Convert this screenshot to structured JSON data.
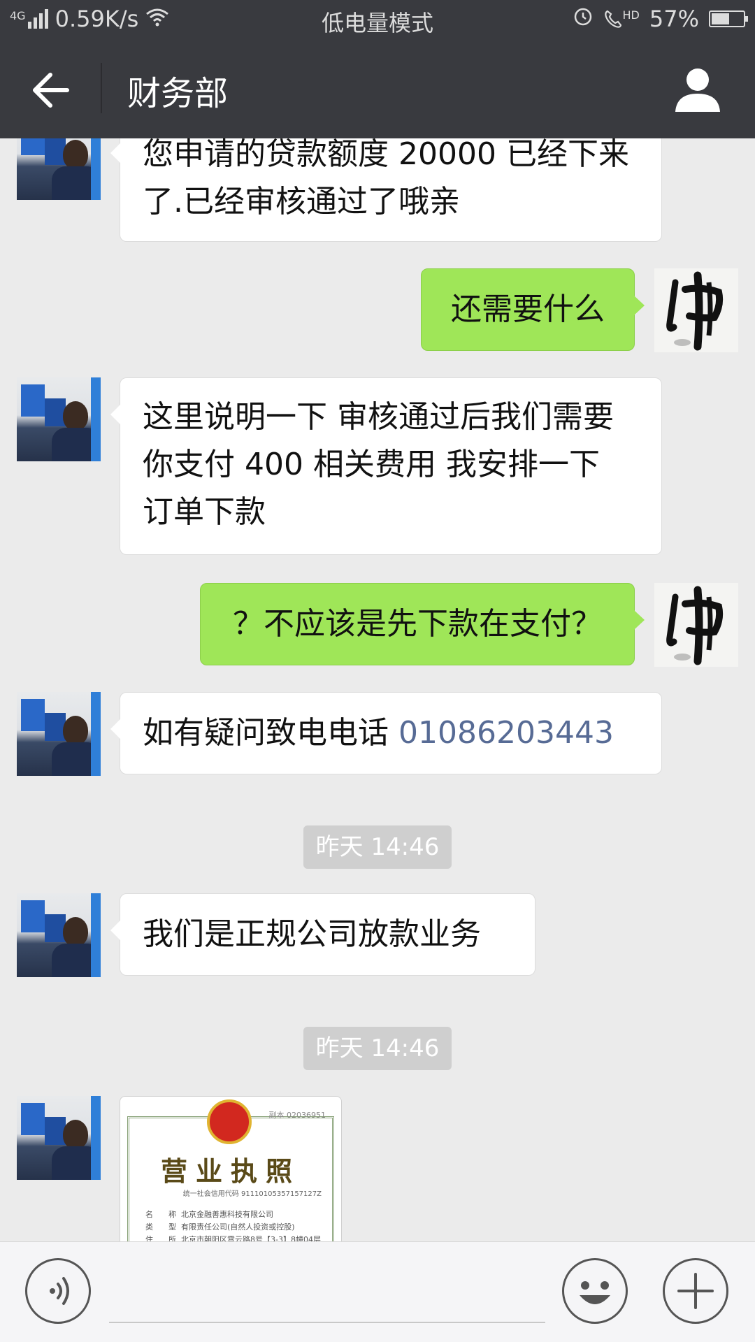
{
  "status_bar": {
    "network": "4G",
    "speed": "0.59K/s",
    "mode": "低电量模式",
    "hd": "HD",
    "battery": "57%",
    "battery_level": 0.57
  },
  "header": {
    "title": "财务部"
  },
  "messages": [
    {
      "from": "them",
      "text_line1": "您申请的贷款额度 20000 已经下来",
      "text_line2": "了.已经审核通过了哦亲"
    },
    {
      "from": "me",
      "text": "还需要什么"
    },
    {
      "from": "them",
      "text_line1": "这里说明一下 审核通过后我们需要",
      "text_line2": "你支付 400 相关费用 我安排一下",
      "text_line3": "订单下款"
    },
    {
      "from": "me",
      "text": "？不应该是先下款在支付？"
    },
    {
      "from": "them",
      "text_prefix": "如有疑问致电电话 ",
      "phone": "01086203443"
    },
    {
      "type": "timestamp",
      "text": "昨天 14:46"
    },
    {
      "from": "them",
      "text": "我们是正规公司放款业务"
    },
    {
      "type": "timestamp",
      "text": "昨天 14:46"
    },
    {
      "from": "them",
      "type": "image",
      "license": {
        "title": "营业执照",
        "serial": "副本 02036951",
        "credit_code": "统一社会信用代码 91110105357157127Z",
        "name_label": "名　　称",
        "name": "北京金融善惠科技有限公司",
        "type_label": "类　　型",
        "type": "有限责任公司(自然人投资或控股)",
        "address_label": "住　　所",
        "address": "北京市朝阳区霄云路8号【3-3】8幢04层"
      }
    }
  ],
  "input_bar": {
    "voice_icon": "voice-icon",
    "emoji_icon": "emoji-icon",
    "plus_icon": "plus-icon"
  }
}
